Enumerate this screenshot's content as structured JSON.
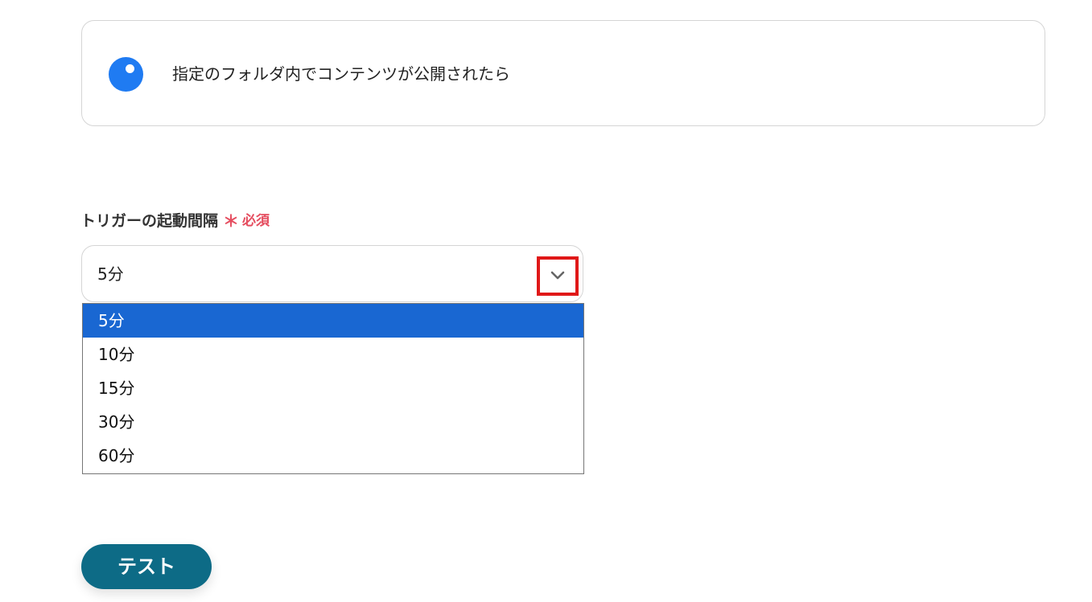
{
  "trigger_card": {
    "icon": "blue-circle-app-icon",
    "title": "指定のフォルダ内でコンテンツが公開されたら"
  },
  "interval_field": {
    "label": "トリガーの起動間隔",
    "required_mark": "＊",
    "required_text": "必須",
    "selected_value": "5分",
    "toggle_icon": "chevron-down-icon",
    "options": [
      "5分",
      "10分",
      "15分",
      "30分",
      "60分"
    ],
    "highlighted_option": "5分"
  },
  "actions": {
    "test_label": "テスト"
  },
  "colors": {
    "app_icon": "#1f7bf2",
    "required": "#e54d5f",
    "highlight": "#1967d2",
    "test_button": "#0d6b86",
    "annotation_box": "#e01818"
  }
}
